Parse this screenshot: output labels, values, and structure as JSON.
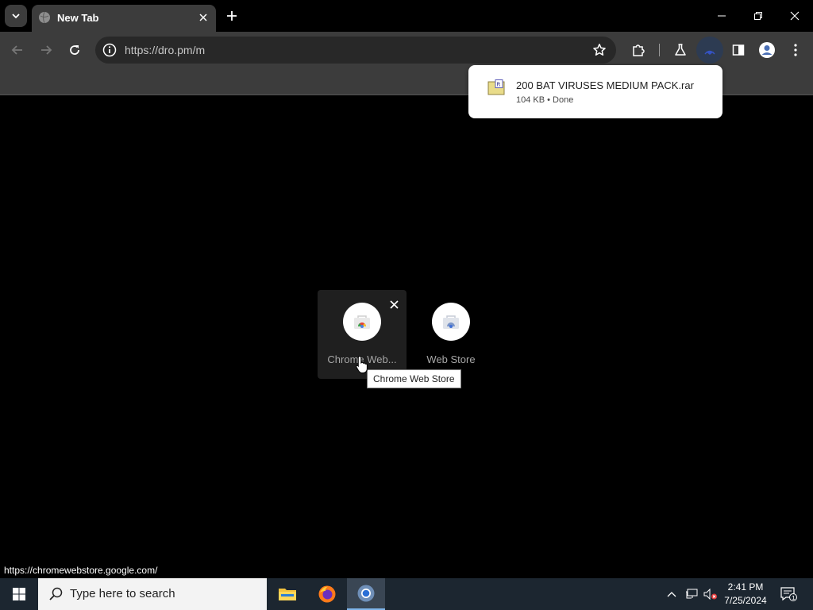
{
  "browser": {
    "tab": {
      "title": "New Tab"
    },
    "address": {
      "url": "https://dro.pm/m"
    }
  },
  "download": {
    "filename": "200 BAT VIRUSES MEDIUM PACK.rar",
    "status": "104 KB • Done"
  },
  "shortcuts": [
    {
      "label": "Chrome Web..."
    },
    {
      "label": "Web Store"
    }
  ],
  "tooltip": {
    "text": "Chrome Web Store"
  },
  "status_bar": {
    "link": "https://chromewebstore.google.com/"
  },
  "taskbar": {
    "search_placeholder": "Type here to search",
    "time": "2:41 PM",
    "date": "7/25/2024",
    "notification_count": "1"
  },
  "colors": {
    "tab_bg": "#3c3c3c",
    "toolbar_bg": "#3c3c3c",
    "page_bg": "#000000",
    "taskbar_bg": "#1c2630"
  }
}
